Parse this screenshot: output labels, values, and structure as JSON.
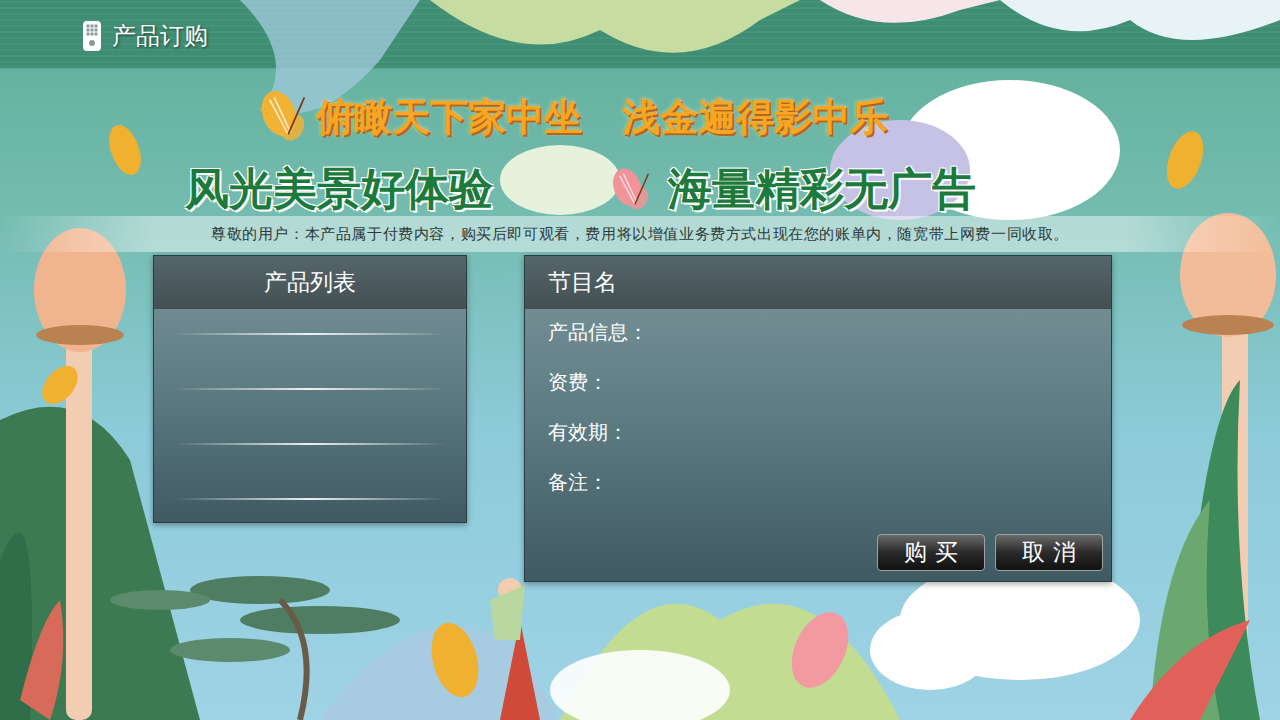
{
  "header": {
    "title": "产品订购"
  },
  "slogan_lines": [
    {
      "kind": "gold",
      "items": [
        "俯瞰天下家中坐",
        "浅金遍得影中乐"
      ]
    },
    {
      "kind": "green",
      "items": [
        "风光美景好体验",
        "海量精彩无广告"
      ]
    }
  ],
  "notice": "尊敬的用户：本产品属于付费内容，购买后即可观看，费用将以增值业务费方式出现在您的账单内，随宽带上网费一同收取。",
  "product_list": {
    "title": "产品列表"
  },
  "detail": {
    "title": "节目名",
    "fields": [
      {
        "label": "产品信息："
      },
      {
        "label": "资费："
      },
      {
        "label": "有效期："
      },
      {
        "label": "备注："
      }
    ]
  },
  "buttons": [
    {
      "label": "购 买",
      "selected": false
    },
    {
      "label": "取 消",
      "selected": false
    }
  ]
}
